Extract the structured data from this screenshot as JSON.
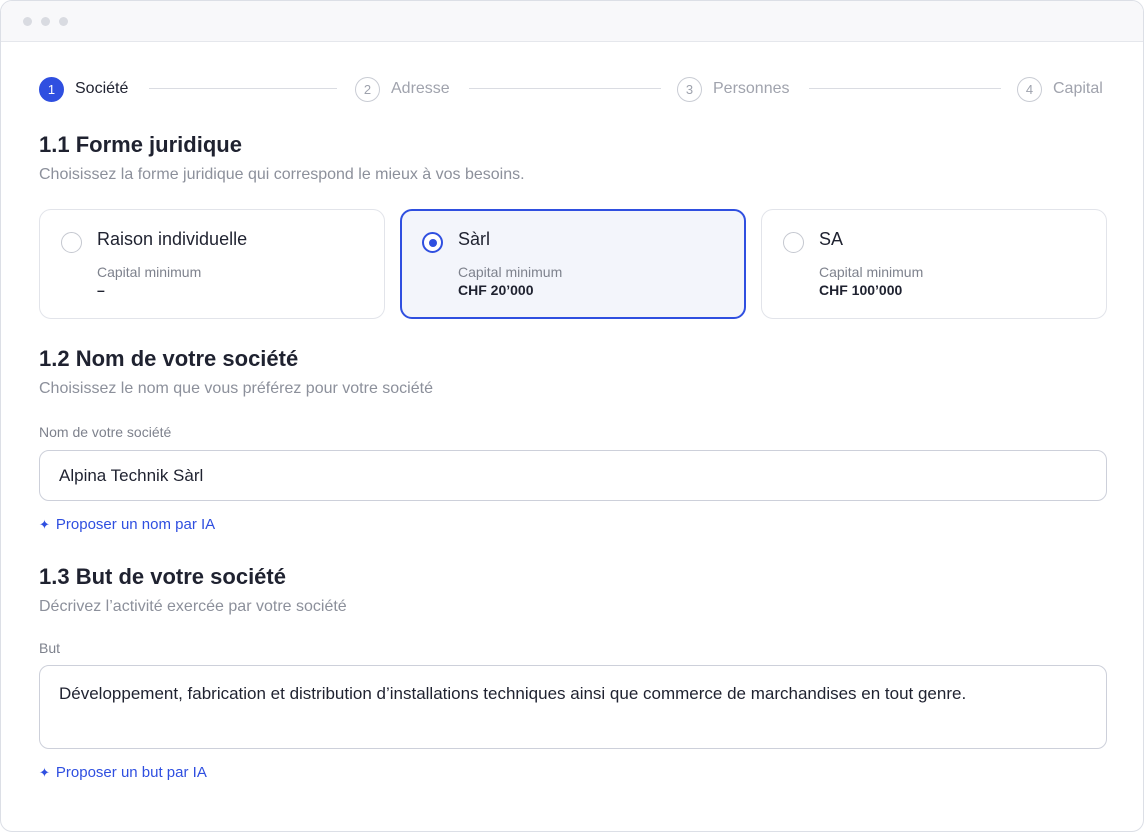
{
  "stepper": {
    "steps": [
      {
        "number": "1",
        "label": "Société",
        "active": true
      },
      {
        "number": "2",
        "label": "Adresse",
        "active": false
      },
      {
        "number": "3",
        "label": "Personnes",
        "active": false
      },
      {
        "number": "4",
        "label": "Capital",
        "active": false
      }
    ]
  },
  "legal_form": {
    "title": "1.1 Forme juridique",
    "subtitle": "Choisissez la forme juridique qui correspond le mieux à vos besoins.",
    "options": [
      {
        "name": "Raison individuelle",
        "capital_label": "Capital minimum",
        "capital_value": "–",
        "selected": false
      },
      {
        "name": "Sàrl",
        "capital_label": "Capital minimum",
        "capital_value": "CHF 20’000",
        "selected": true
      },
      {
        "name": "SA",
        "capital_label": "Capital minimum",
        "capital_value": "CHF 100’000",
        "selected": false
      }
    ]
  },
  "company_name": {
    "title": "1.2 Nom de votre société",
    "subtitle": "Choisissez le nom que vous préférez pour votre société",
    "field_label": "Nom de votre société",
    "value": "Alpina Technik Sàrl",
    "ai_link": "Proposer un nom par IA",
    "ai_icon": "sparkle-icon"
  },
  "purpose": {
    "title": "1.3 But de votre société",
    "subtitle": "Décrivez l’activité exercée par votre société",
    "field_label": "But",
    "value": "Développement, fabrication et distribution d’installations techniques ainsi que commerce de marchandises en tout genre.",
    "ai_link": "Proposer un but par IA",
    "ai_icon": "sparkle-icon"
  },
  "colors": {
    "accent": "#2f4fe0",
    "muted_text": "#8c909b",
    "selected_card_bg": "#f3f5fb"
  }
}
